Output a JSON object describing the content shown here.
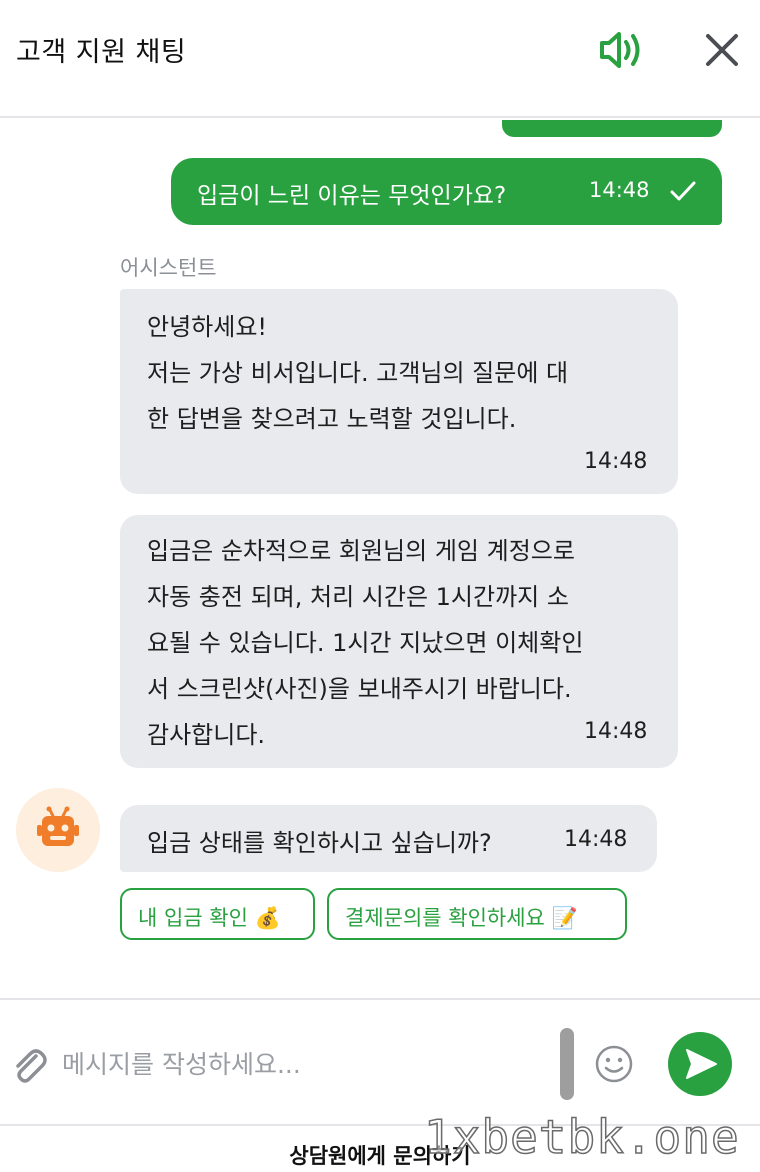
{
  "header": {
    "title": "고객 지원 채팅",
    "sound_icon": "speaker-volume-icon",
    "close_icon": "close-icon"
  },
  "colors": {
    "accent": "#2aa140",
    "bubble_bg": "#e8eaed",
    "avatar_bg": "#fdeede",
    "bot_icon": "#f07d2a"
  },
  "messages": {
    "outgoing": {
      "text": "입금이 느린 이유는 무엇인가요?",
      "time": "14:48"
    },
    "assistant_name": "어시스턴트",
    "bubble1": {
      "lines": [
        "안녕하세요!",
        "저는 가상 비서입니다. 고객님의 질문에 대",
        "한 답변을 찾으려고 노력할 것입니다."
      ],
      "time": "14:48"
    },
    "bubble2": {
      "lines": [
        "입금은 순차적으로 회원님의 게임 계정으로",
        "자동 충전 되며, 처리 시간은 1시간까지 소",
        "요될 수 있습니다. 1시간 지났으면 이체확인",
        "서 스크린샷(사진)을 보내주시기 바랍니다.",
        "감사합니다."
      ],
      "time": "14:48"
    },
    "bubble3": {
      "text": "입금 상태를 확인하시고 싶습니까?",
      "time": "14:48"
    }
  },
  "quick_replies": [
    "내 입금 확인 💰",
    "결제문의를 확인하세요 📝"
  ],
  "composer": {
    "placeholder": "메시지를 작성하세요...",
    "value": ""
  },
  "footer": {
    "contact_agent": "상담원에게 문의하기"
  },
  "watermark": "1xbetbk.one"
}
